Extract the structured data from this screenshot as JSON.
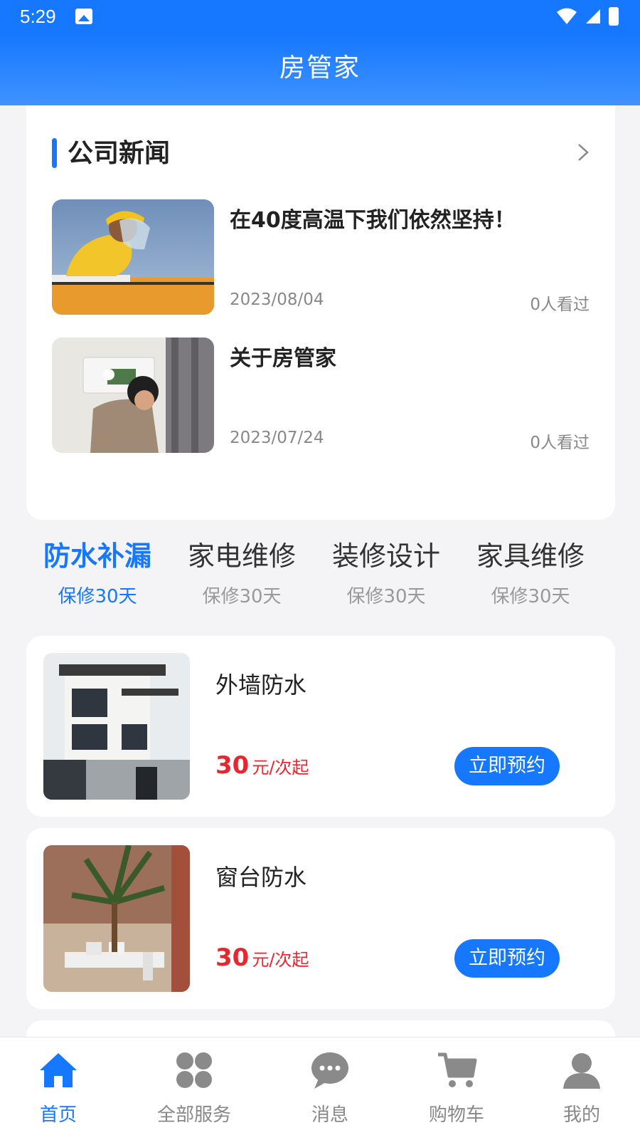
{
  "status_bar": {
    "time": "5:29"
  },
  "app_bar": {
    "title": "房管家"
  },
  "news": {
    "section_title": "公司新闻",
    "items": [
      {
        "title": "在40度高温下我们依然坚持！",
        "date": "2023/08/04",
        "views": "0人看过"
      },
      {
        "title": "关于房管家",
        "date": "2023/07/24",
        "views": "0人看过"
      }
    ]
  },
  "categories": [
    {
      "name": "防水补漏",
      "sub": "保修30天",
      "active": true
    },
    {
      "name": "家电维修",
      "sub": "保修30天",
      "active": false
    },
    {
      "name": "装修设计",
      "sub": "保修30天",
      "active": false
    },
    {
      "name": "家具维修",
      "sub": "保修30天",
      "active": false
    }
  ],
  "products": [
    {
      "name": "外墙防水",
      "price": "30",
      "unit": "元/次起",
      "button": "立即预约"
    },
    {
      "name": "窗台防水",
      "price": "30",
      "unit": "元/次起",
      "button": "立即预约"
    }
  ],
  "tabbar": {
    "items": [
      {
        "label": "首页",
        "icon": "home-icon",
        "active": true
      },
      {
        "label": "全部服务",
        "icon": "grid-icon",
        "active": false
      },
      {
        "label": "消息",
        "icon": "chat-icon",
        "active": false
      },
      {
        "label": "购物车",
        "icon": "cart-icon",
        "active": false
      },
      {
        "label": "我的",
        "icon": "user-icon",
        "active": false
      }
    ]
  },
  "colors": {
    "primary": "#1677ff",
    "price": "#e8262f",
    "background": "#f4f4f6"
  }
}
